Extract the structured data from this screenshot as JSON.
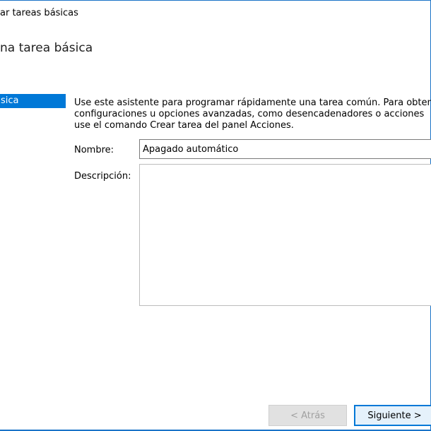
{
  "window": {
    "title": "ar tareas básicas"
  },
  "page": {
    "heading": "na tarea básica"
  },
  "steps": [
    {
      "label": "sica",
      "active": true
    }
  ],
  "intro": {
    "lines": [
      "Use este asistente para programar rápidamente una tarea común. Para obten",
      "configuraciones u opciones avanzadas, como desencadenadores o acciones",
      "use el comando Crear tarea del panel Acciones."
    ]
  },
  "form": {
    "name_label": "Nombre:",
    "name_value": "Apagado automático",
    "description_label": "Descripción:",
    "description_value": ""
  },
  "buttons": {
    "back": "< Atrás",
    "next": "Siguiente >"
  },
  "colors": {
    "accent": "#0078d7",
    "frame": "#1a73c8"
  }
}
